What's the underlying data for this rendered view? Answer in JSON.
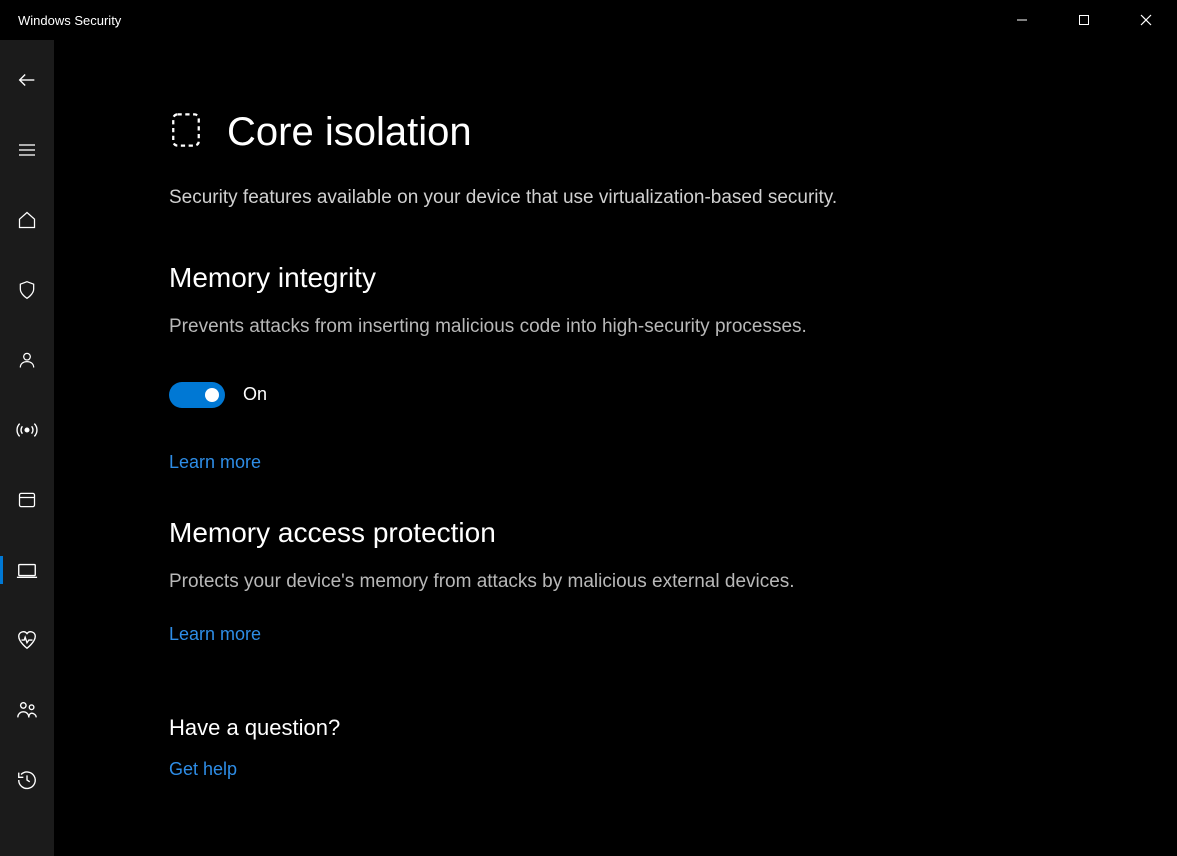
{
  "window": {
    "title": "Windows Security"
  },
  "page": {
    "title": "Core isolation",
    "subtitle": "Security features available on your device that use virtualization-based security."
  },
  "memory_integrity": {
    "title": "Memory integrity",
    "description": "Prevents attacks from inserting malicious code into high-security processes.",
    "toggle_state": "On",
    "learn_more": "Learn more"
  },
  "memory_access": {
    "title": "Memory access protection",
    "description": "Protects your device's memory from attacks by malicious external devices.",
    "learn_more": "Learn more"
  },
  "help": {
    "title": "Have a question?",
    "link": "Get help"
  }
}
